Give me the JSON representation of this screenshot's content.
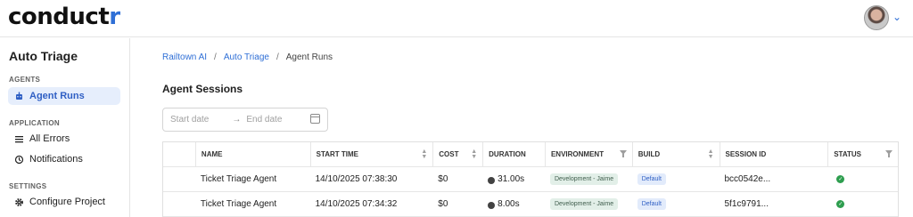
{
  "app": {
    "logo_main": "conduct",
    "logo_accent": "r"
  },
  "sidebar": {
    "project_title": "Auto Triage",
    "sections": [
      {
        "label": "AGENTS"
      },
      {
        "label": "APPLICATION"
      },
      {
        "label": "SETTINGS"
      }
    ],
    "items": [
      {
        "label": "Agent Runs",
        "icon": "robot-icon",
        "active": true
      },
      {
        "label": "All Errors",
        "icon": "list-icon"
      },
      {
        "label": "Notifications",
        "icon": "history-icon"
      },
      {
        "label": "Configure Project",
        "icon": "gear-icon"
      }
    ]
  },
  "breadcrumb": {
    "items": [
      "Railtown AI",
      "Auto Triage",
      "Agent Runs"
    ],
    "separator": "/"
  },
  "page": {
    "title": "Agent Sessions"
  },
  "date_filter": {
    "start_placeholder": "Start date",
    "end_placeholder": "End date",
    "arrow": "→"
  },
  "table": {
    "columns": [
      "NAME",
      "START TIME",
      "COST",
      "DURATION",
      "ENVIRONMENT",
      "BUILD",
      "SESSION ID",
      "STATUS"
    ],
    "rows": [
      {
        "name": "Ticket Triage Agent",
        "start_time": "14/10/2025 07:38:30",
        "cost": "$0",
        "duration": "31.00s",
        "environment": "Development - Jaime",
        "build": "Default",
        "session_id": "bcc0542e...",
        "status": "success"
      },
      {
        "name": "Ticket Triage Agent",
        "start_time": "14/10/2025 07:34:32",
        "cost": "$0",
        "duration": "8.00s",
        "environment": "Development - Jaime",
        "build": "Default",
        "session_id": "5f1c9791...",
        "status": "success"
      }
    ]
  },
  "colors": {
    "accent": "#2f6fd6",
    "active_nav_bg": "#e6eefc",
    "success": "#2e9e4f",
    "env_badge_bg": "#e2efe8",
    "build_badge_bg": "#e2ebfb"
  }
}
